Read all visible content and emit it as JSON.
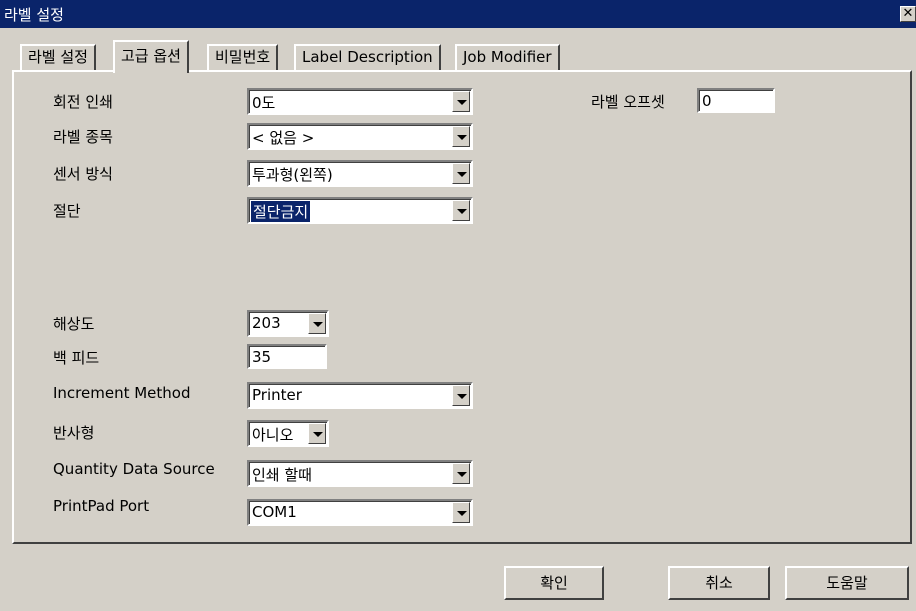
{
  "window": {
    "title": "라벨 설정",
    "close_label": "✕"
  },
  "tabs": [
    {
      "label": "라벨 설정"
    },
    {
      "label": "고급 옵션"
    },
    {
      "label": "비밀번호"
    },
    {
      "label": "Label Description"
    },
    {
      "label": "Job Modifier"
    }
  ],
  "fields": {
    "rotation": {
      "label": "회전 인쇄",
      "value": "0도"
    },
    "label_stock": {
      "label": "라벨 종목",
      "value": "< 없음 >"
    },
    "sensor": {
      "label": "센서 방식",
      "value": "투과형(왼쪽)"
    },
    "cutter": {
      "label": "절단",
      "value": "절단금지"
    },
    "resolution": {
      "label": "해상도",
      "value": "203"
    },
    "backfeed": {
      "label": "백 피드",
      "value": "35"
    },
    "increment": {
      "label": "Increment Method",
      "value": "Printer"
    },
    "reflective": {
      "label": "반사형",
      "value": "아니오"
    },
    "quantity_source": {
      "label": "Quantity Data Source",
      "value": "인쇄 할때"
    },
    "printpad_port": {
      "label": "PrintPad Port",
      "value": "COM1"
    },
    "label_offset": {
      "label": "라벨 오프셋",
      "value": "0"
    }
  },
  "buttons": {
    "ok": "확인",
    "cancel": "취소",
    "help": "도움말"
  }
}
